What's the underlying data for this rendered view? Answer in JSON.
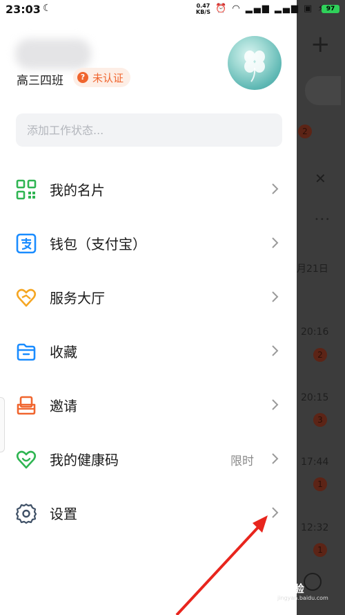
{
  "status_bar": {
    "time": "23:03",
    "net_speed": "0.47",
    "net_unit": "KB/S",
    "battery": "97"
  },
  "profile": {
    "subtitle": "高三四班",
    "auth_badge": "未认证",
    "status_placeholder": "添加工作状态..."
  },
  "menu": [
    {
      "label": "我的名片",
      "icon": "qr-code-icon",
      "extra": ""
    },
    {
      "label": "钱包（支付宝）",
      "icon": "alipay-icon",
      "extra": ""
    },
    {
      "label": "服务大厅",
      "icon": "heart-hands-icon",
      "extra": ""
    },
    {
      "label": "收藏",
      "icon": "folder-icon",
      "extra": ""
    },
    {
      "label": "邀请",
      "icon": "invite-icon",
      "extra": ""
    },
    {
      "label": "我的健康码",
      "icon": "health-heart-icon",
      "extra": "限时"
    },
    {
      "label": "设置",
      "icon": "gear-icon",
      "extra": ""
    }
  ],
  "background_app": {
    "date_fragment": "月21日",
    "times": [
      "20:16",
      "20:15",
      "17:44",
      "12:32"
    ],
    "badges": [
      "2",
      "2",
      "3",
      "1",
      "1"
    ]
  },
  "watermark": {
    "text": "Bai经验",
    "sub": "jingyan.baidu.com"
  },
  "colors": {
    "green": "#2fb552",
    "blue": "#1a8cff",
    "orange": "#f0652e",
    "gold": "#f5a623",
    "arrow_red": "#e8251d"
  }
}
